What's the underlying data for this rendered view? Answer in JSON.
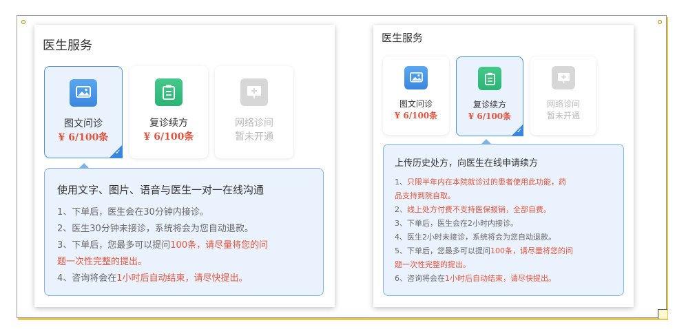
{
  "left": {
    "title": "医生服务",
    "cards": [
      {
        "name": "图文问诊",
        "price": "¥ 6/100条",
        "icon": "image-icon",
        "state": "selected"
      },
      {
        "name": "复诊续方",
        "price": "¥ 6/100条",
        "icon": "clipboard-icon",
        "state": "normal"
      },
      {
        "name": "网络诊间",
        "price": "暂未开通",
        "icon": "monitor-plus-icon",
        "state": "disabled"
      }
    ],
    "desc_title": "使用文字、图片、语音与医生一对一在线沟通",
    "lines": [
      {
        "a": "1、下单后，医生会在30分钟内接诊。",
        "b": ""
      },
      {
        "a": "2、医生30分钟未接诊，系统将会为您自动退款。",
        "b": ""
      },
      {
        "a": "3、下单后，您最多可以提问",
        "b": "100条，请尽量将您的问"
      },
      {
        "a": "",
        "b": "题一次性完整的提出。"
      },
      {
        "a": "4、咨询将会在",
        "b": "1小时后自动结束，请尽快提出。"
      }
    ]
  },
  "right": {
    "title": "医生服务",
    "cards": [
      {
        "name": "图文问诊",
        "price": "¥ 6/100条",
        "icon": "image-icon",
        "state": "normal"
      },
      {
        "name": "复诊续方",
        "price": "¥ 6/100条",
        "icon": "clipboard-icon",
        "state": "selected"
      },
      {
        "name": "网络诊间",
        "price": "暂未开通",
        "icon": "monitor-plus-icon",
        "state": "disabled"
      }
    ],
    "desc_title": "上传历史处方，向医生在线申请续方",
    "lines": [
      {
        "a": "1、",
        "b": "只限半年内在本院就诊过的患者使用此功能，药"
      },
      {
        "a": "",
        "b": "品支持到院自取。"
      },
      {
        "a": "2、",
        "b": "线上处方付费不支持医保报销，全部自费。"
      },
      {
        "a": "3、下单后，医生会在2小时内接诊。",
        "b": ""
      },
      {
        "a": "4、医生2小时未接诊，系统将会为您自动退款。",
        "b": ""
      },
      {
        "a": "5、下单后，您最多可以提问",
        "b": "100条，请尽量将您的问"
      },
      {
        "a": "",
        "b": "题一次性完整的提出。"
      },
      {
        "a": "6、咨询将会在",
        "b": "1小时后自动结束，请尽快提出。"
      }
    ]
  },
  "colors": {
    "accent": "#3b86df",
    "price": "#e0533f",
    "green": "#2bb475"
  }
}
